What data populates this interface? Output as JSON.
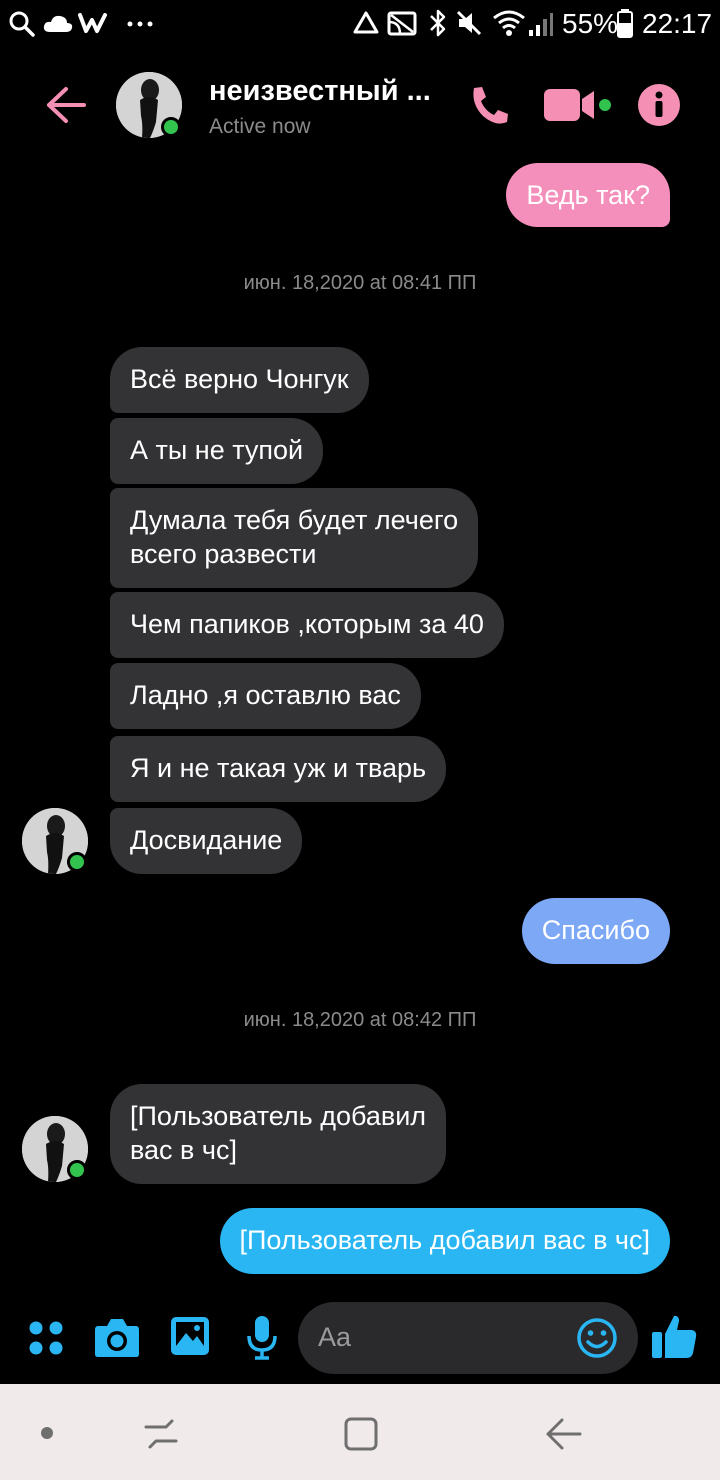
{
  "status_bar": {
    "battery_percent": "55%",
    "clock": "22:17",
    "icons": [
      "search-icon",
      "cloud-icon",
      "w-app-icon",
      "more-dots-icon",
      "recycle-icon",
      "cast-icon",
      "bluetooth-icon",
      "mute-icon",
      "wifi-icon",
      "signal-icon",
      "battery-icon"
    ]
  },
  "header": {
    "contact_name": "неизвестный ...",
    "status": "Active now",
    "accent_color": "#f58fb4",
    "online_color": "#31c34d"
  },
  "conversation": {
    "messages": [
      {
        "side": "out",
        "text": "Ведь так?",
        "color": "#f48fbb"
      },
      {
        "type": "timestamp",
        "text": "июн. 18,2020 at 08:41 ПП"
      },
      {
        "side": "in",
        "text": "Всё верно Чонгук"
      },
      {
        "side": "in",
        "text": "А ты не тупой"
      },
      {
        "side": "in",
        "text": "Думала тебя будет лечего\nвсего развести"
      },
      {
        "side": "in",
        "text": "Чем папиков ,которым за 40"
      },
      {
        "side": "in",
        "text": "Ладно ,я оставлю вас"
      },
      {
        "side": "in",
        "text": "Я и не такая уж и тварь"
      },
      {
        "side": "in",
        "text": "Досвидание"
      },
      {
        "side": "out",
        "text": "Спасибо",
        "color": "#7da8f5"
      },
      {
        "type": "timestamp",
        "text": "июн. 18,2020 at 08:42 ПП"
      },
      {
        "side": "in",
        "text": "[Пользователь добавил\nвас в чс]"
      },
      {
        "side": "out",
        "text": "[Пользователь добавил вас в чс]",
        "color": "#29b6f3"
      }
    ]
  },
  "composer": {
    "placeholder": "Aa",
    "icon_color": "#29b6f3",
    "icons": [
      "apps-icon",
      "camera-icon",
      "gallery-icon",
      "microphone-icon",
      "emoji-icon",
      "thumbs-up-icon"
    ]
  },
  "nav_bar": {
    "icons": [
      "dot-icon",
      "recents-icon",
      "home-icon",
      "back-icon"
    ]
  }
}
